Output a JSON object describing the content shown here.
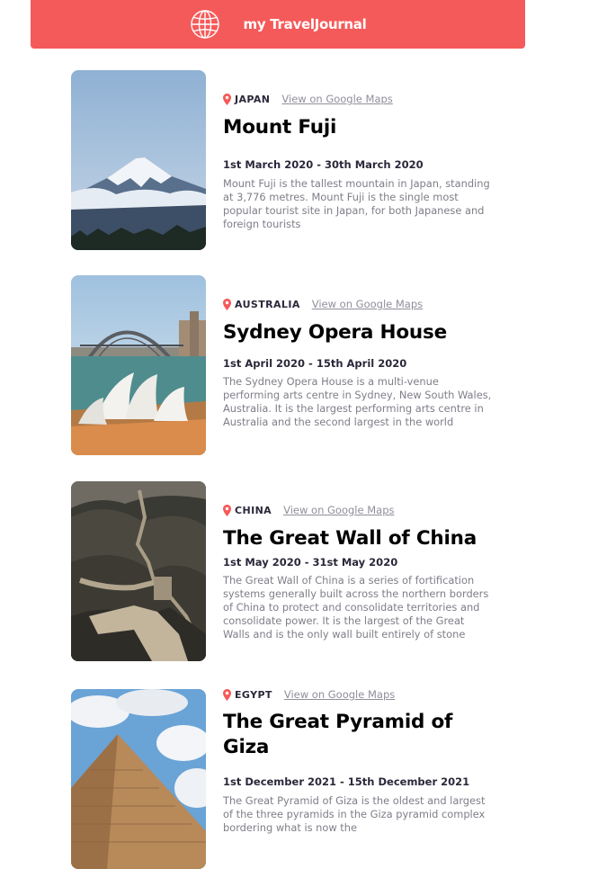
{
  "header": {
    "title": "my TravelJournal",
    "icon": "globe-icon",
    "background": "#F55A5A"
  },
  "entries": [
    {
      "location": "JAPAN",
      "maps_label": "View on Google Maps",
      "title": "Mount Fuji",
      "dates": "1st March 2020 - 30th March 2020",
      "description": "Mount Fuji is the tallest mountain in Japan, standing at 3,776 metres. Mount Fuji is the single most popular tourist site in Japan, for both Japanese and foreign tourists"
    },
    {
      "location": "AUSTRALIA",
      "maps_label": "View on Google Maps",
      "title": "Sydney Opera House",
      "dates": "1st April 2020 - 15th April 2020",
      "description": "The Sydney Opera House is a multi-venue performing arts centre in Sydney, New South Wales, Australia. It is the largest performing arts centre in Australia and the second largest in the world"
    },
    {
      "location": "CHINA",
      "maps_label": "View on Google Maps",
      "title": "The Great Wall of China",
      "dates": "1st May 2020 - 31st May 2020",
      "description": "The Great Wall of China is a series of fortification systems generally built across the northern borders of China to protect and consolidate territories and consolidate power. It is the largest of the Great Walls and is the only wall built entirely of stone"
    },
    {
      "location": "EGYPT",
      "maps_label": "View on Google Maps",
      "title_line1": "The Great Pyramid of",
      "title_line2": "Giza",
      "dates": "1st December 2021 - 15th December 2021",
      "description": "The Great Pyramid of Giza is the oldest and largest of the three pyramids in the Giza pyramid complex bordering what is now the"
    }
  ]
}
